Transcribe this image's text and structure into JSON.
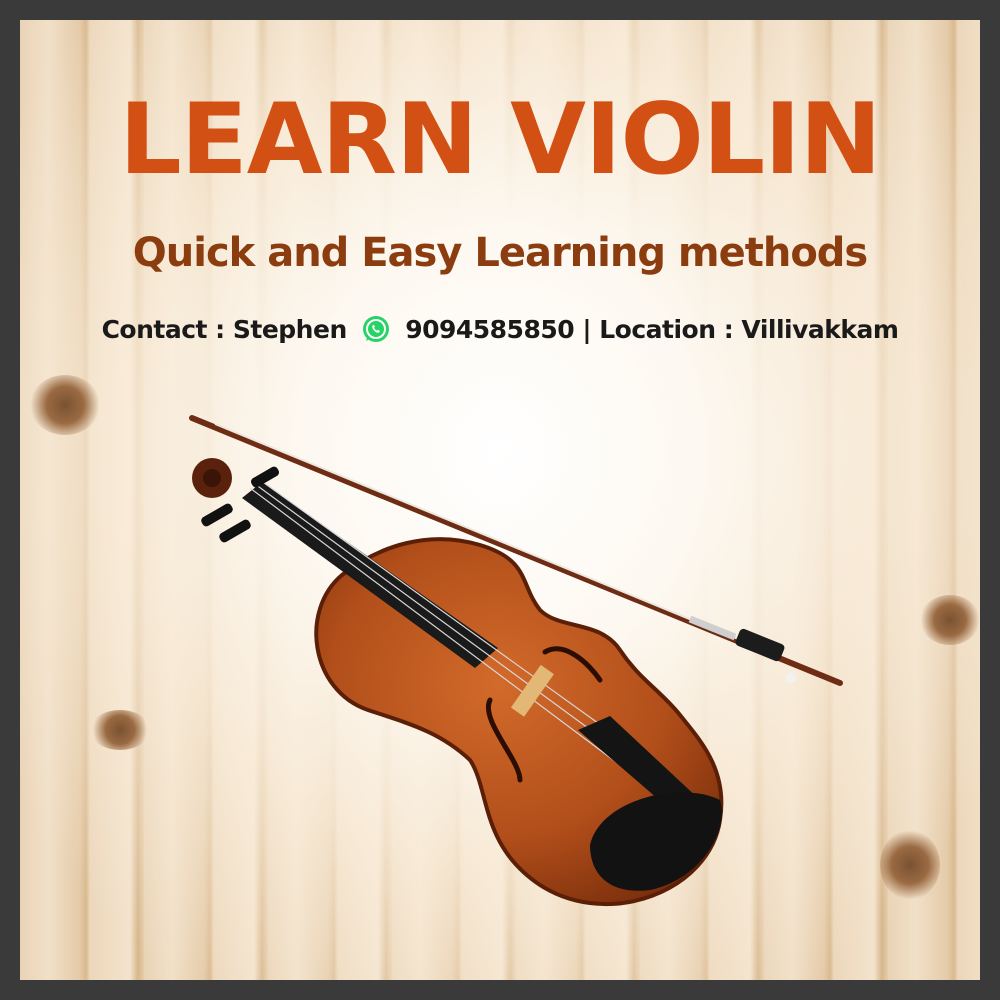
{
  "poster": {
    "title": "LEARN VIOLIN",
    "subtitle": "Quick and Easy Learning methods",
    "contact_label": "Contact : Stephen",
    "phone": "9094585850",
    "separator": "|",
    "location_label": "Location : Villivakkam"
  },
  "icons": {
    "contact_icon": "whatsapp-icon",
    "illustration": "violin-and-bow"
  },
  "colors": {
    "title": "#d35014",
    "subtitle": "#8b3d10",
    "contact_text": "#1a1a1a",
    "border": "#3a3a3a",
    "whatsapp": "#25d366",
    "violin_body": "#b8521c"
  }
}
